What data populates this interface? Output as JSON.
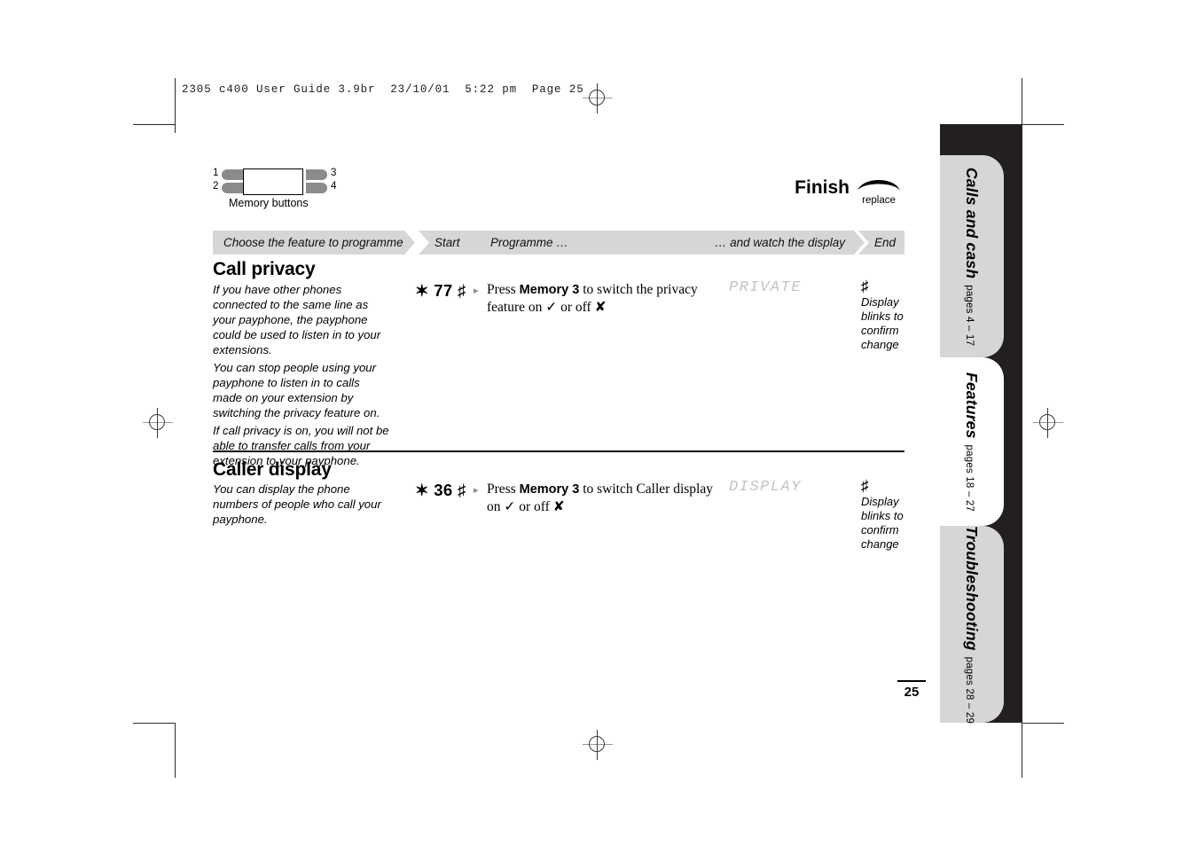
{
  "print_slug": "2305 c400 User Guide 3.9br  23/10/01  5:22 pm  Page 25",
  "diagram": {
    "caption": "Memory buttons",
    "labels": {
      "one": "1",
      "two": "2",
      "three": "3",
      "four": "4"
    }
  },
  "finish": {
    "label": "Finish",
    "icon": "handset-replace-icon",
    "sub_label": "replace"
  },
  "banner": {
    "choose": "Choose the feature to programme",
    "start": "Start",
    "programme": "Programme …",
    "watch": "… and watch the display",
    "end": "End"
  },
  "sections": [
    {
      "title": "Call privacy",
      "description": [
        "If you have other phones connected to the same line as your payphone, the payphone could be used to listen in to your extensions.",
        "You can stop people using your payphone to listen in to calls made on your extension by switching the privacy feature on.",
        "If call privacy is on, you will not be able to transfer calls from your extension to your payphone."
      ],
      "code": "✶ 77 ♯",
      "bullet": "▸",
      "instruction_prefix": "Press ",
      "instruction_key": "Memory 3",
      "instruction_suffix": " to switch the privacy feature on ✓ or off ✘",
      "lcd": "PRIVATE",
      "end_symbol": "♯",
      "end_note": "Display blinks to confirm change"
    },
    {
      "title": "Caller display",
      "description": [
        "You can display the phone numbers of people who call your payphone."
      ],
      "code": "✶ 36 ♯",
      "bullet": "▸",
      "instruction_prefix": "Press ",
      "instruction_key": "Memory 3",
      "instruction_suffix": " to switch Caller display on ✓ or off ✘",
      "lcd": "DISPLAY",
      "end_symbol": "♯",
      "end_note": "Display blinks to confirm change"
    }
  ],
  "sidebar": {
    "tabs": [
      {
        "name": "Calls and cash",
        "pages": "pages 4 – 17",
        "active": false
      },
      {
        "name": "Features",
        "pages": "pages 18 – 27",
        "active": true
      },
      {
        "name": "Troubleshooting",
        "pages": "pages 28 – 29",
        "active": false
      }
    ]
  },
  "page_number": "25",
  "colors": {
    "banner_gray": "#d6d6d6",
    "tab_black": "#231f20",
    "lcd_gray": "#c3c3c3",
    "key_gray": "#8b8b8b"
  }
}
